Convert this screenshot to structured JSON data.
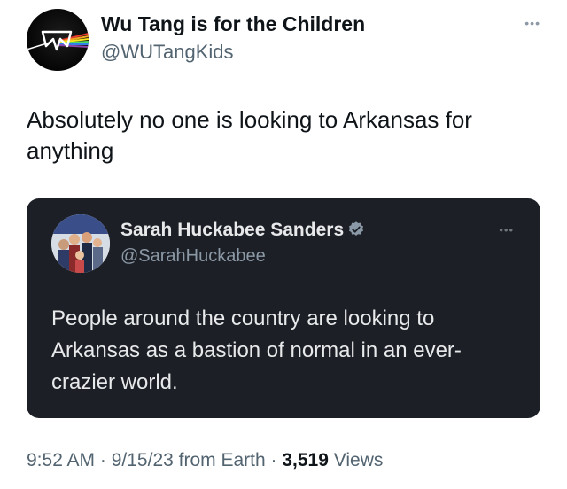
{
  "tweet": {
    "author": {
      "display_name": "Wu Tang is for the Children",
      "handle": "@WUTangKids",
      "avatar": "wu-tang-logo-avatar"
    },
    "more_icon": "more-icon",
    "text": "Absolutely no one is looking to Arkansas for anything"
  },
  "quoted_tweet": {
    "author": {
      "display_name": "Sarah Huckabee Sanders",
      "handle": "@SarahHuckabee",
      "avatar": "family-photo-avatar",
      "verified_icon": "verified-badge-icon"
    },
    "text": "People around the country are looking to Arkansas as a bastion of normal in an ever-crazier world."
  },
  "meta": {
    "time": "9:52 AM",
    "sep1": " · ",
    "date": "9/15/23",
    "source": " from Earth",
    "sep2": " · ",
    "views_count": "3,519",
    "views_label": " Views"
  },
  "colors": {
    "quote_background": "#1c1f26",
    "secondary_text": "#536471",
    "verified": "#8b98a5"
  }
}
